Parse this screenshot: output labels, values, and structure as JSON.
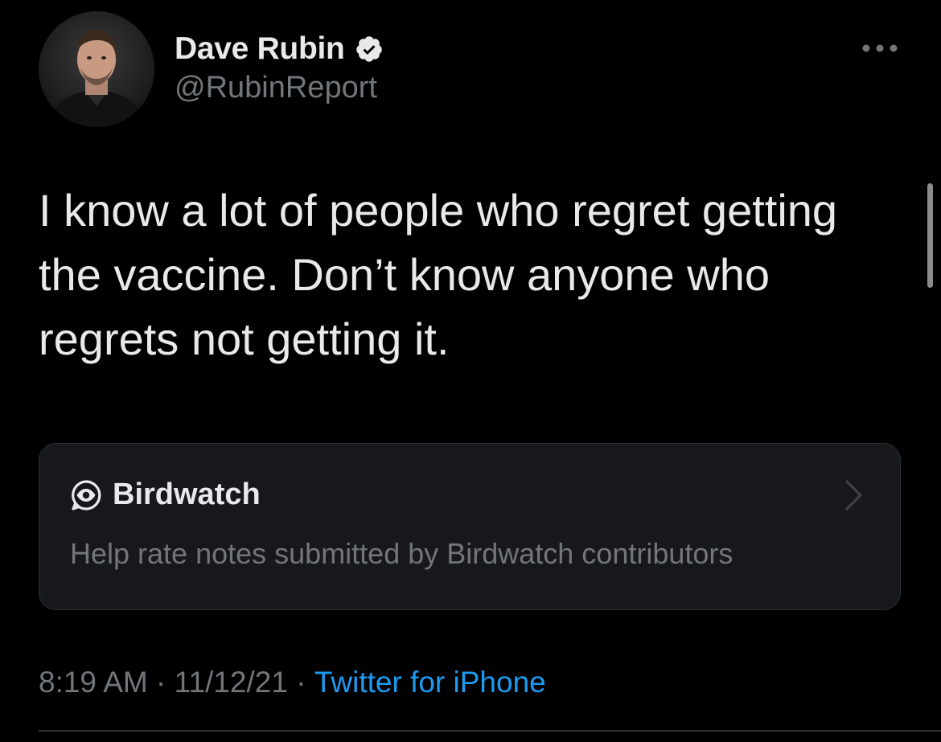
{
  "author": {
    "display_name": "Dave Rubin",
    "handle": "@RubinReport",
    "verified": true,
    "avatar": "profile-photo-avatar"
  },
  "tweet": {
    "text": "I know a lot of people who regret getting\nthe vaccine. Don’t know anyone who\nregrets not getting it."
  },
  "birdwatch": {
    "icon": "birdwatch-eye-icon",
    "title": "Birdwatch",
    "description": "Help rate notes submitted by Birdwatch contributors"
  },
  "meta": {
    "time": "8:19 AM",
    "separator": " · ",
    "date": "11/12/21",
    "source": "Twitter for iPhone"
  },
  "colors": {
    "background": "#000000",
    "text_primary": "#e7e9ea",
    "text_secondary": "#71767b",
    "accent": "#1d9bf0",
    "verified_badge": "#e7e9ea",
    "card_background": "#16181c",
    "border": "#2f3336"
  }
}
